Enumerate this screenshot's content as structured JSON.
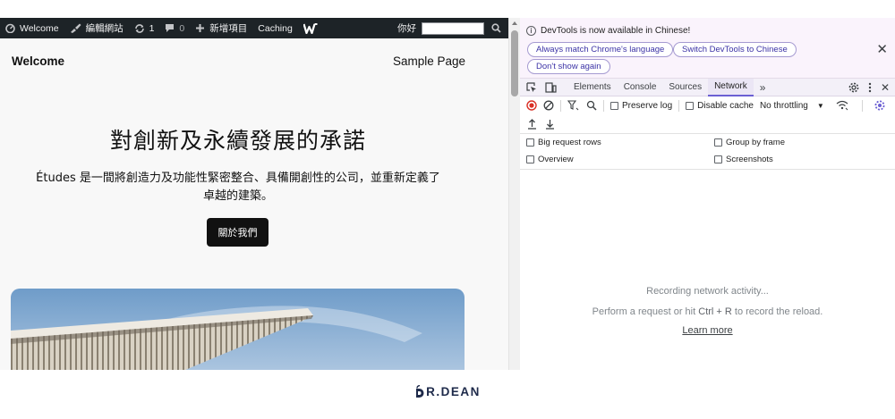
{
  "admin_bar": {
    "site_name": "Welcome",
    "edit_site": "編輯網站",
    "updates_count": "1",
    "comments_count": "0",
    "new_item": "新增項目",
    "caching": "Caching",
    "greeting": "你好"
  },
  "site": {
    "title": "Welcome",
    "nav_link": "Sample Page",
    "hero_title": "對創新及永續發展的承諾",
    "hero_text": "Études 是一間將創造力及功能性緊密整合、具備開創性的公司，並重新定義了卓越的建築。",
    "hero_button": "關於我們"
  },
  "devtools": {
    "info_message": "DevTools is now available in Chinese!",
    "info_buttons": [
      "Always match Chrome's language",
      "Switch DevTools to Chinese",
      "Don't show again"
    ],
    "tabs": [
      "Elements",
      "Console",
      "Sources",
      "Network"
    ],
    "active_tab": "Network",
    "preserve_log": "Preserve log",
    "disable_cache": "Disable cache",
    "throttling": "No throttling",
    "settings": {
      "big_request_rows": "Big request rows",
      "group_by_frame": "Group by frame",
      "overview": "Overview",
      "screenshots": "Screenshots"
    },
    "empty_line1": "Recording network activity...",
    "empty_line2_prefix": "Perform a request or hit",
    "empty_line2_key": "Ctrl + R",
    "empty_line2_suffix": "to record the reload.",
    "learn_more": "Learn more"
  },
  "footer": {
    "logo_text": "R.DEAN"
  },
  "colors": {
    "admin_bar_bg": "#1d2327",
    "devtools_accent": "#6b5fd3",
    "record_red": "#d93025",
    "logo_navy": "#1e2a4a"
  }
}
